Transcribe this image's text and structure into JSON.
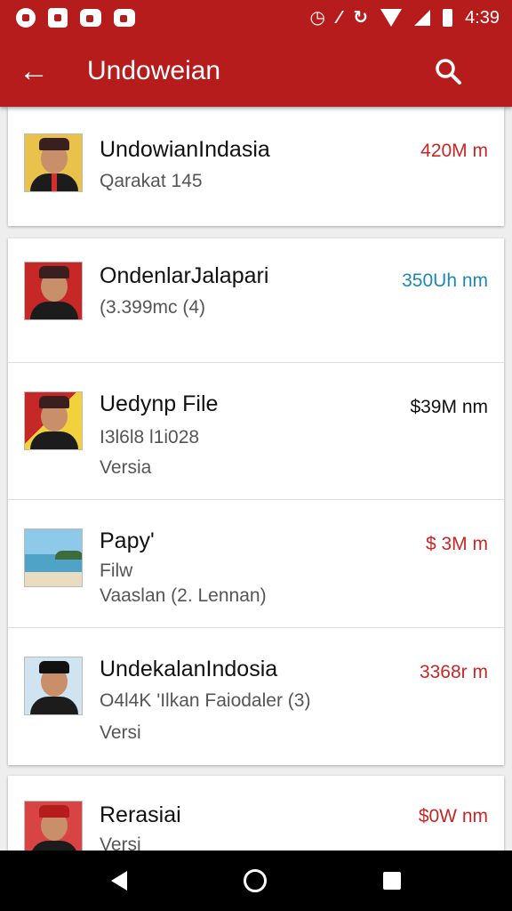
{
  "app": {
    "title": "Undoweian",
    "accent": "#b71c1c"
  },
  "statusbar": {
    "time": "4:39",
    "icons": [
      "app-notification-icon",
      "image-icon",
      "message-icon",
      "video-icon",
      "alarm-icon",
      "no-sim-icon",
      "data-saver-icon",
      "wifi-icon",
      "signal-icon",
      "battery-icon"
    ]
  },
  "toolbar": {
    "back_icon": "arrow-back-icon",
    "search_icon": "search-icon"
  },
  "items": [
    {
      "name": "UndowianIndasia",
      "sub": "Qarakat 145",
      "extra": "",
      "size": "420M m",
      "size_color": "#c62828",
      "thumb": "portrait-yellow"
    },
    {
      "name": "OndenlarJalapari",
      "sub": "(3.399mc (4)",
      "extra": "",
      "size": "350Uh nm",
      "size_color": "#1e88b5",
      "thumb": "portrait-red"
    },
    {
      "name": "Uedynp File",
      "sub": "I3l6l8 l1i028",
      "extra": "Versia",
      "size": "$39M nm",
      "size_color": "#111111",
      "thumb": "portrait-flag"
    },
    {
      "name": "Papy'",
      "sub": "Filw",
      "extra": "Vaaslan (2. Lennan)",
      "size": "$ 3M m",
      "size_color": "#c62828",
      "thumb": "beach"
    },
    {
      "name": "UndekalanIndosia",
      "sub": "O4l4K 'Ilkan Faiodaler (3)",
      "extra": "Versi",
      "size": "3368r m",
      "size_color": "#c62828",
      "thumb": "portrait-blue"
    },
    {
      "name": "Rerasiai",
      "sub": "Versi",
      "extra": "",
      "size": "$0W nm",
      "size_color": "#c62828",
      "thumb": "portrait-red2"
    }
  ],
  "navbar": {
    "icons": [
      "nav-back-icon",
      "nav-home-icon",
      "nav-recents-icon"
    ]
  }
}
